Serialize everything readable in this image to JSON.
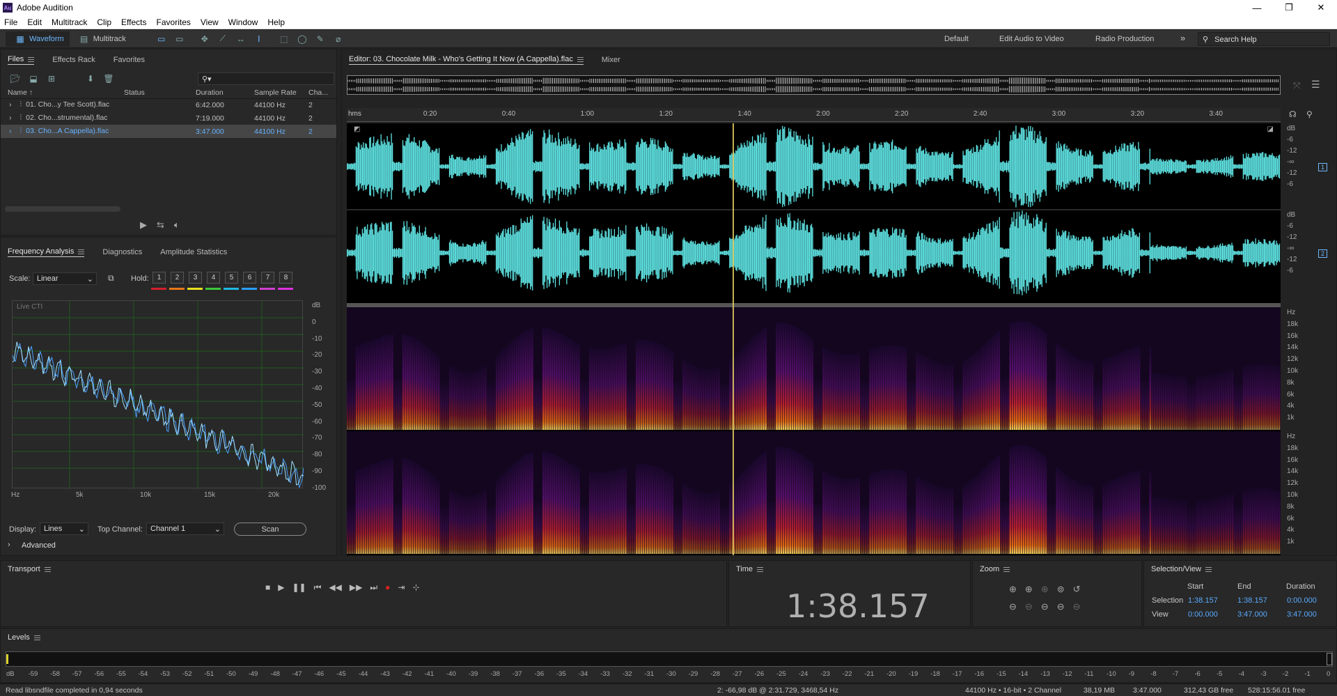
{
  "app": {
    "title": "Adobe Audition",
    "logo": "Au"
  },
  "menu": [
    "File",
    "Edit",
    "Multitrack",
    "Clip",
    "Effects",
    "Favorites",
    "View",
    "Window",
    "Help"
  ],
  "toolbar": {
    "waveform_label": "Waveform",
    "multitrack_label": "Multitrack",
    "workspaces": [
      "Default",
      "Edit Audio to Video",
      "Radio Production"
    ],
    "more": "»",
    "search_placeholder": "Search Help"
  },
  "files_panel": {
    "tabs": [
      "Files",
      "Effects Rack",
      "Favorites"
    ],
    "columns": [
      "Name ↑",
      "Status",
      "Duration",
      "Sample Rate",
      "Cha..."
    ],
    "rows": [
      {
        "name": "01. Cho...y Tee Scott).flac",
        "status": "",
        "duration": "6:42.000",
        "rate": "44100 Hz",
        "ch": "2",
        "selected": false
      },
      {
        "name": "02. Cho...strumental).flac",
        "status": "",
        "duration": "7:19.000",
        "rate": "44100 Hz",
        "ch": "2",
        "selected": false
      },
      {
        "name": "03. Cho...A Cappella).flac",
        "status": "",
        "duration": "3:47.000",
        "rate": "44100 Hz",
        "ch": "2",
        "selected": true
      }
    ],
    "search_placeholder": "⚲▾"
  },
  "analysis_panel": {
    "tabs": [
      "Frequency Analysis",
      "Diagnostics",
      "Amplitude Statistics"
    ],
    "scale_label": "Scale:",
    "scale_value": "Linear",
    "hold_label": "Hold:",
    "hold_buttons": [
      "1",
      "2",
      "3",
      "4",
      "5",
      "6",
      "7",
      "8"
    ],
    "hold_colors": [
      "#d4202c",
      "#e87818",
      "#e8e020",
      "#3cc83c",
      "#20b8e0",
      "#2a9fff",
      "#d040d0",
      "#e030e0"
    ],
    "live_label": "Live CTI",
    "db_axis": [
      "dB",
      "0",
      "-10",
      "-20",
      "-30",
      "-40",
      "-50",
      "-60",
      "-70",
      "-80",
      "-90",
      "-100"
    ],
    "hz_axis": [
      "Hz",
      "5k",
      "10k",
      "15k",
      "20k"
    ],
    "display_label": "Display:",
    "display_value": "Lines",
    "top_channel_label": "Top Channel:",
    "top_channel_value": "Channel 1",
    "scan_label": "Scan",
    "advanced_label": "Advanced"
  },
  "editor": {
    "tab_label": "Editor: 03. Chocolate Milk - Who's Getting It Now (A Cappella).flac",
    "mixer_label": "Mixer",
    "ruler_unit": "hms",
    "ruler_ticks": [
      "0:20",
      "0:40",
      "1:00",
      "1:20",
      "1:40",
      "2:00",
      "2:20",
      "2:40",
      "3:00",
      "3:20",
      "3:40"
    ],
    "playhead_time_s": 98.157,
    "total_s": 227,
    "db_scale": [
      "dB",
      "-6",
      "-12",
      "-∞",
      "-12",
      "-6"
    ],
    "channels": [
      "1",
      "2"
    ],
    "hz_scale": [
      "Hz",
      "18k",
      "16k",
      "14k",
      "12k",
      "10k",
      "8k",
      "6k",
      "4k",
      "1k"
    ],
    "waveform_color": "#5fe3e3"
  },
  "transport": {
    "title": "Transport",
    "buttons": [
      "■",
      "▶",
      "❚❚",
      "⏮",
      "◀◀",
      "▶▶",
      "⏭",
      "●",
      "⇥",
      "⊹"
    ]
  },
  "time_panel": {
    "title": "Time",
    "value": "1:38.157"
  },
  "zoom_panel": {
    "title": "Zoom"
  },
  "selection_view": {
    "title": "Selection/View",
    "headers": [
      "Start",
      "End",
      "Duration"
    ],
    "selection": {
      "label": "Selection",
      "start": "1:38.157",
      "end": "1:38.157",
      "duration": "0:00.000"
    },
    "view": {
      "label": "View",
      "start": "0:00.000",
      "end": "3:47.000",
      "duration": "3:47.000"
    }
  },
  "levels": {
    "title": "Levels",
    "scale": [
      "dB",
      "-59",
      "-58",
      "-57",
      "-56",
      "-55",
      "-54",
      "-53",
      "-52",
      "-51",
      "-50",
      "-49",
      "-48",
      "-47",
      "-46",
      "-45",
      "-44",
      "-43",
      "-42",
      "-41",
      "-40",
      "-39",
      "-38",
      "-37",
      "-36",
      "-35",
      "-34",
      "-33",
      "-32",
      "-31",
      "-30",
      "-29",
      "-28",
      "-27",
      "-26",
      "-25",
      "-24",
      "-23",
      "-22",
      "-21",
      "-20",
      "-19",
      "-18",
      "-17",
      "-16",
      "-15",
      "-14",
      "-13",
      "-12",
      "-11",
      "-10",
      "-9",
      "-8",
      "-7",
      "-6",
      "-5",
      "-4",
      "-3",
      "-2",
      "-1",
      "0"
    ]
  },
  "status_bar": {
    "message": "Read libsndfile completed in 0,94 seconds",
    "cursor": "2: -66,98 dB @ 2:31.729, 3468,54 Hz",
    "format": "44100 Hz • 16-bit • 2 Channel",
    "size": "38,19 MB",
    "duration": "3:47.000",
    "free": "312,43 GB free",
    "free_time": "528:15:56.01 free"
  }
}
